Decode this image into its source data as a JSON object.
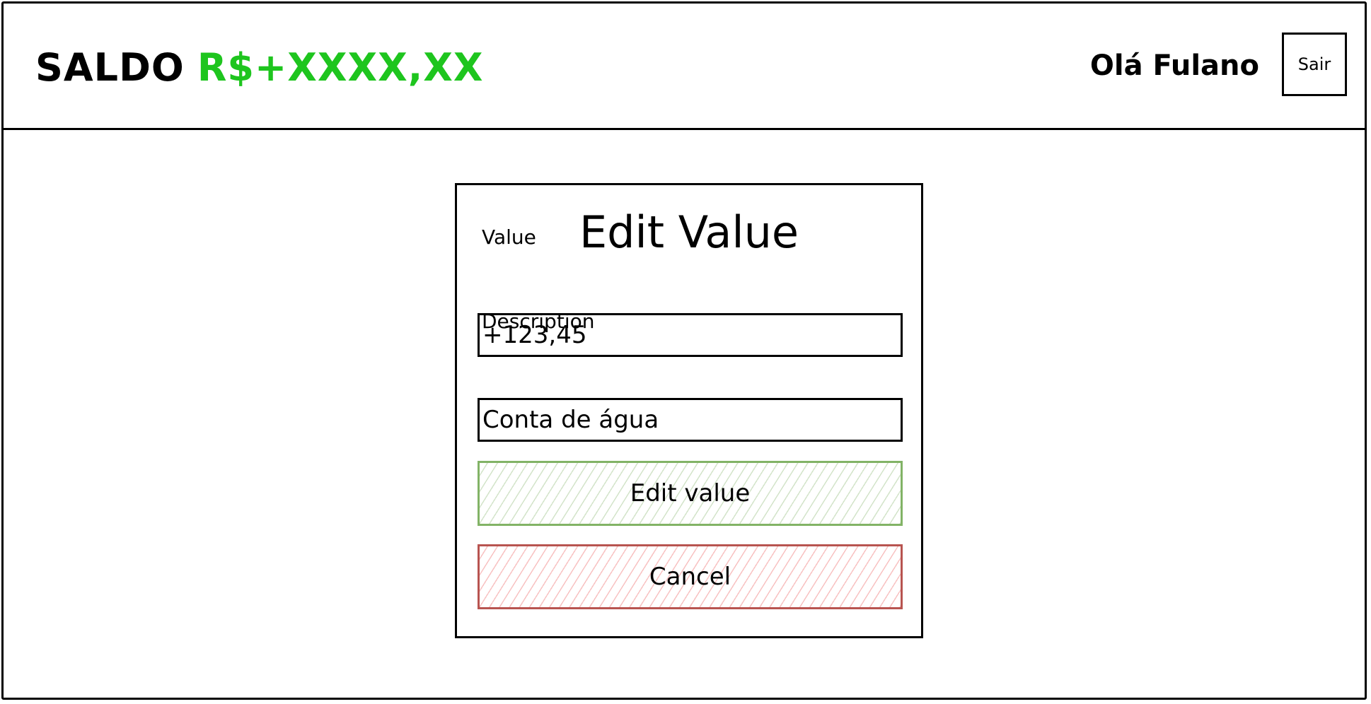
{
  "header": {
    "balance_label": "SALDO",
    "balance_value": "R$+XXXX,XX",
    "greeting": "Olá Fulano",
    "logout_label": "Sair"
  },
  "modal": {
    "title": "Edit Value",
    "value_label": "Value",
    "value_input": "+123,45",
    "description_label": "Description",
    "description_input": "Conta de água",
    "submit_label": "Edit value",
    "cancel_label": "Cancel"
  },
  "colors": {
    "balance_value": "#1ec51e",
    "submit_border": "#82b366",
    "cancel_border": "#b85450"
  }
}
